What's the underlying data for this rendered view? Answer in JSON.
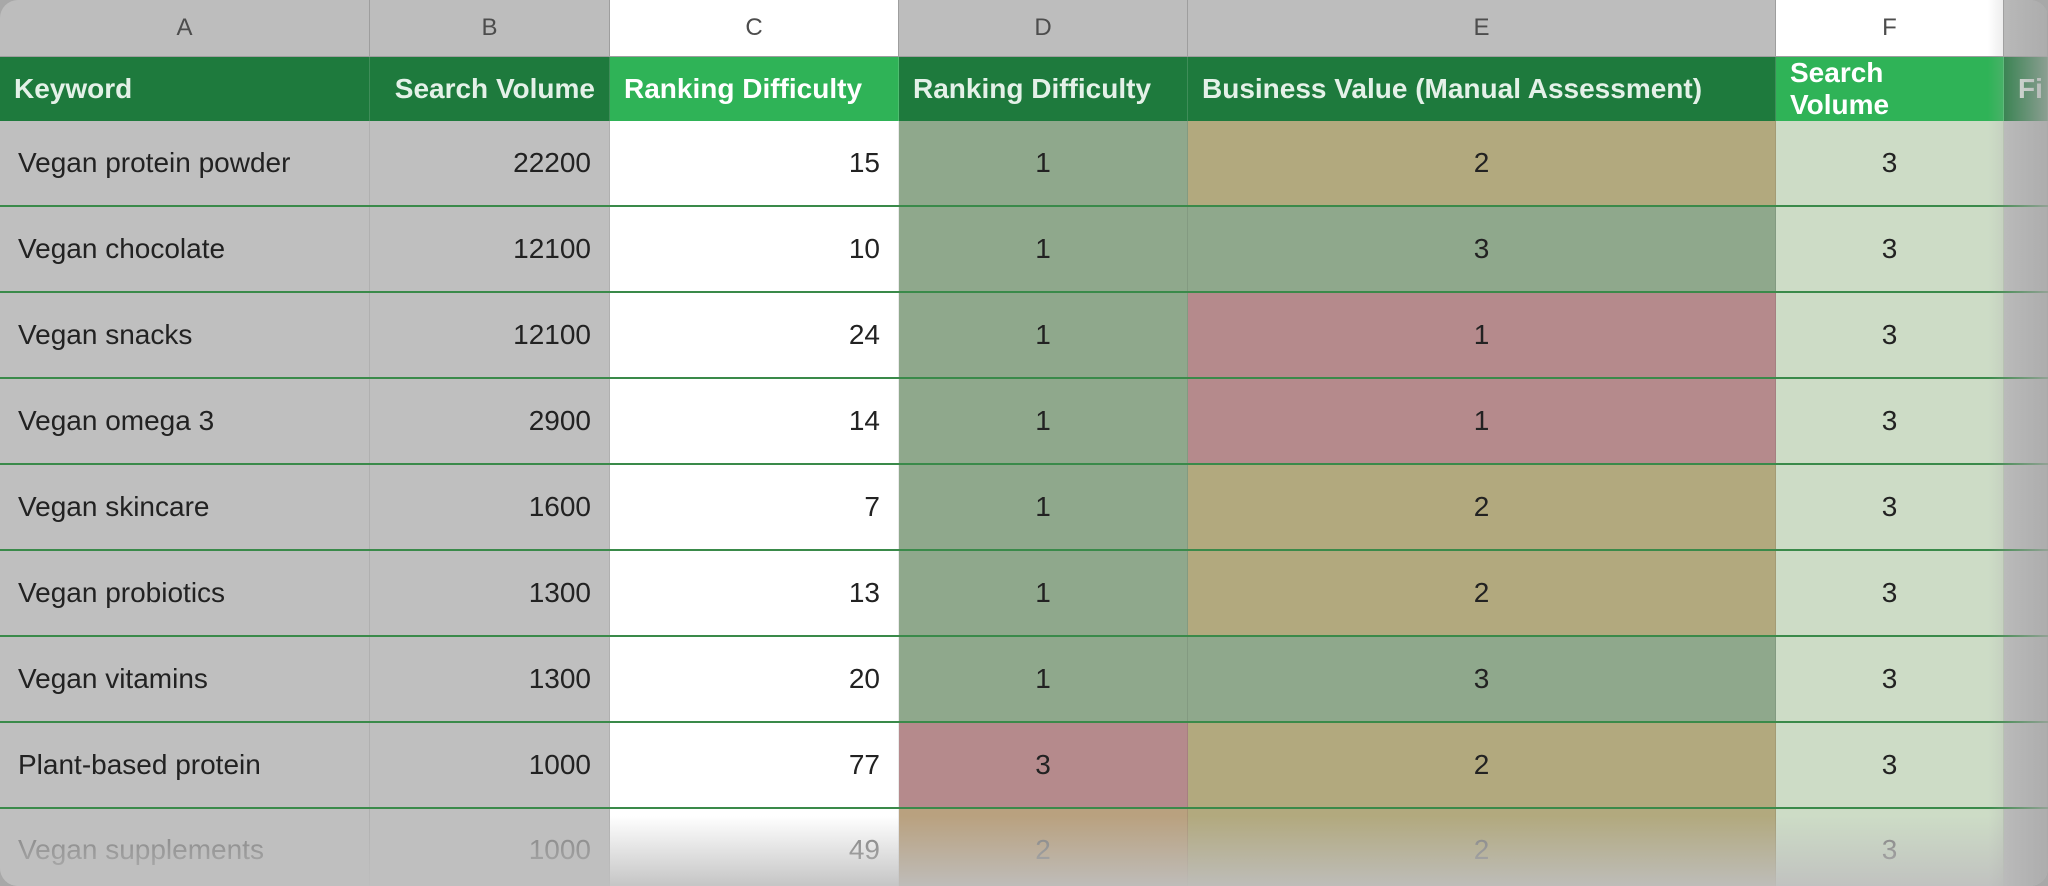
{
  "columns": {
    "letters": [
      "A",
      "B",
      "C",
      "D",
      "E",
      "F"
    ],
    "last_letter_partial": "",
    "headers": {
      "A": "Keyword",
      "B": "Search Volume",
      "C": "Ranking Difficulty",
      "D": "Ranking Difficulty",
      "E": "Business Value (Manual Assessment)",
      "F": "Search Volume",
      "G": "Fi"
    }
  },
  "rows": [
    {
      "keyword": "Vegan protein powder",
      "search_volume": "22200",
      "ranking_difficulty_raw": "15",
      "ranking_difficulty_score": "1",
      "business_value": "2",
      "search_volume_score": "3"
    },
    {
      "keyword": "Vegan chocolate",
      "search_volume": "12100",
      "ranking_difficulty_raw": "10",
      "ranking_difficulty_score": "1",
      "business_value": "3",
      "search_volume_score": "3"
    },
    {
      "keyword": "Vegan snacks",
      "search_volume": "12100",
      "ranking_difficulty_raw": "24",
      "ranking_difficulty_score": "1",
      "business_value": "1",
      "search_volume_score": "3"
    },
    {
      "keyword": "Vegan omega 3",
      "search_volume": "2900",
      "ranking_difficulty_raw": "14",
      "ranking_difficulty_score": "1",
      "business_value": "1",
      "search_volume_score": "3"
    },
    {
      "keyword": "Vegan skincare",
      "search_volume": "1600",
      "ranking_difficulty_raw": "7",
      "ranking_difficulty_score": "1",
      "business_value": "2",
      "search_volume_score": "3"
    },
    {
      "keyword": "Vegan probiotics",
      "search_volume": "1300",
      "ranking_difficulty_raw": "13",
      "ranking_difficulty_score": "1",
      "business_value": "2",
      "search_volume_score": "3"
    },
    {
      "keyword": "Vegan vitamins",
      "search_volume": "1300",
      "ranking_difficulty_raw": "20",
      "ranking_difficulty_score": "1",
      "business_value": "3",
      "search_volume_score": "3"
    },
    {
      "keyword": "Plant-based protein",
      "search_volume": "1000",
      "ranking_difficulty_raw": "77",
      "ranking_difficulty_score": "3",
      "business_value": "2",
      "search_volume_score": "3"
    },
    {
      "keyword": "Vegan supplements",
      "search_volume": "1000",
      "ranking_difficulty_raw": "49",
      "ranking_difficulty_score": "2",
      "business_value": "2",
      "search_volume_score": "3"
    }
  ],
  "chart_data": {
    "type": "table",
    "title": "",
    "columns": [
      "Keyword",
      "Search Volume",
      "Ranking Difficulty",
      "Ranking Difficulty",
      "Business Value (Manual Assessment)",
      "Search Volume"
    ],
    "rows": [
      [
        "Vegan protein powder",
        22200,
        15,
        1,
        2,
        3
      ],
      [
        "Vegan chocolate",
        12100,
        10,
        1,
        3,
        3
      ],
      [
        "Vegan snacks",
        12100,
        24,
        1,
        1,
        3
      ],
      [
        "Vegan omega 3",
        2900,
        14,
        1,
        1,
        3
      ],
      [
        "Vegan skincare",
        1600,
        7,
        1,
        2,
        3
      ],
      [
        "Vegan probiotics",
        1300,
        13,
        1,
        2,
        3
      ],
      [
        "Vegan vitamins",
        1300,
        20,
        1,
        3,
        3
      ],
      [
        "Plant-based protein",
        1000,
        77,
        3,
        2,
        3
      ],
      [
        "Vegan supplements",
        1000,
        49,
        2,
        2,
        3
      ]
    ],
    "traffic_light_legend": {
      "1": "green",
      "2": "yellow",
      "3": "red"
    }
  }
}
